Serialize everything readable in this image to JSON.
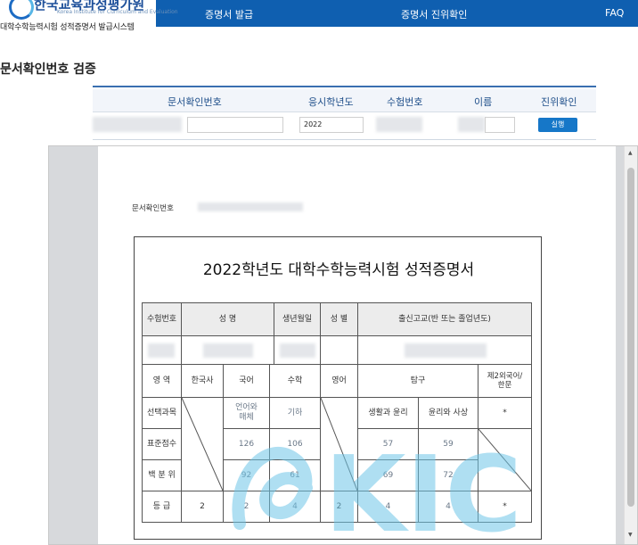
{
  "header": {
    "org_name": "한국교육과정평가원",
    "org_name_en": "Korea Institute for Curriculum and Evaluation",
    "system_name": "대학수학능력시험 성적증명서 발급시스템",
    "nav": [
      "증명서 발급",
      "증명서 진위확인",
      "FAQ"
    ]
  },
  "page_title": "문서확인번호 검증",
  "search": {
    "headers": [
      "문서확인번호",
      "응시학년도",
      "수험번호",
      "이름",
      "진위확인"
    ],
    "exam_year_value": "2022",
    "submit_label": "실행"
  },
  "document": {
    "doc_no_label": "문서확인번호",
    "title": "2022학년도 대학수학능력시험 성적증명서",
    "info_headers": [
      "수험번호",
      "성  명",
      "생년월일",
      "성 별",
      "출신고교(반 또는 졸업년도)"
    ],
    "area_label": "영   역",
    "subjects": [
      "한국사",
      "국어",
      "수학",
      "영어",
      "탐구",
      "제2외국어/한문"
    ],
    "row_labels": [
      "선택과목",
      "표준점수",
      "백 분 위",
      "등    급"
    ],
    "selected": {
      "korean": "언어와 매체",
      "math": "기하",
      "inquiry1": "생활과 윤리",
      "inquiry2": "윤리와 사상",
      "foreign": "*"
    },
    "standard": {
      "korean": "126",
      "math": "106",
      "inquiry1": "57",
      "inquiry2": "59"
    },
    "percentile": {
      "korean": "92",
      "math": "61",
      "inquiry1": "69",
      "inquiry2": "72"
    },
    "grade": {
      "history": "2",
      "korean": "2",
      "math": "4",
      "english": "2",
      "inquiry1": "4",
      "inquiry2": "4",
      "foreign": "*"
    },
    "watermark_text": "KICE"
  },
  "colors": {
    "nav_bg": "#0f5fb0",
    "accent": "#1677c8",
    "watermark": "#6ec6e8"
  }
}
